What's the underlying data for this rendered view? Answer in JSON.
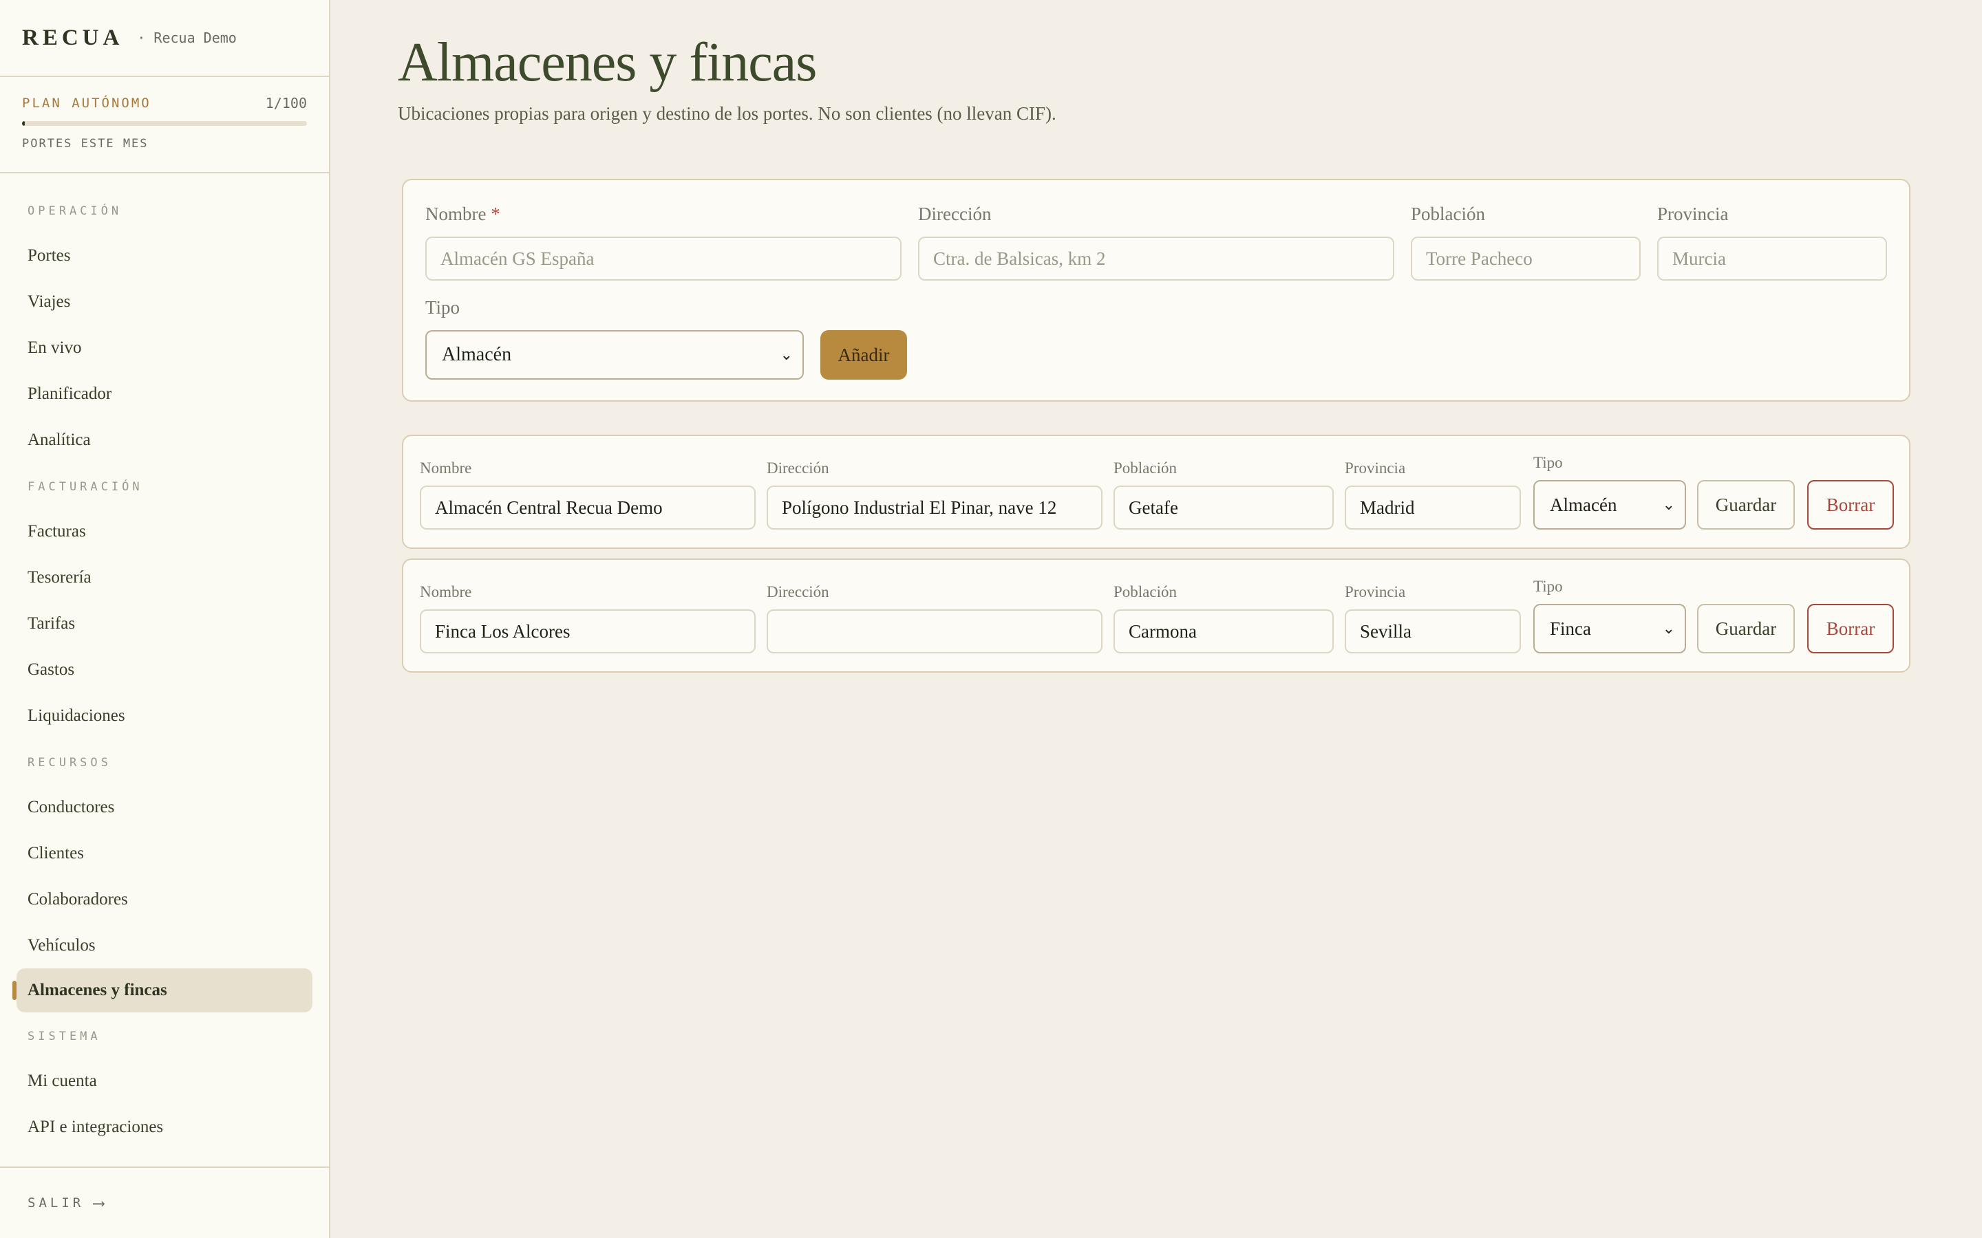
{
  "brand": {
    "logo": "RECUA",
    "workspace": "· Recua Demo"
  },
  "plan": {
    "name": "PLAN AUTÓNOMO",
    "count": "1/100",
    "label": "PORTES ESTE MES",
    "usage_fraction": 0.01
  },
  "nav": {
    "sections": [
      {
        "title": "OPERACIÓN",
        "items": [
          "Portes",
          "Viajes",
          "En vivo",
          "Planificador",
          "Analítica"
        ]
      },
      {
        "title": "FACTURACIÓN",
        "items": [
          "Facturas",
          "Tesorería",
          "Tarifas",
          "Gastos",
          "Liquidaciones"
        ]
      },
      {
        "title": "RECURSOS",
        "items": [
          "Conductores",
          "Clientes",
          "Colaboradores",
          "Vehículos",
          "Almacenes y fincas"
        ]
      },
      {
        "title": "SISTEMA",
        "items": [
          "Mi cuenta",
          "API e integraciones"
        ]
      }
    ],
    "active": "Almacenes y fincas",
    "logout": "SALIR",
    "logout_arrow": "⟶"
  },
  "page": {
    "title": "Almacenes y fincas",
    "subtitle": "Ubicaciones propias para origen y destino de los portes. No son clientes (no llevan CIF)."
  },
  "new_form": {
    "nombre_label": "Nombre",
    "required_mark": "*",
    "nombre_placeholder": "Almacén GS España",
    "direccion_label": "Dirección",
    "direccion_placeholder": "Ctra. de Balsicas, km 2",
    "poblacion_label": "Población",
    "poblacion_placeholder": "Torre Pacheco",
    "provincia_label": "Provincia",
    "provincia_placeholder": "Murcia",
    "tipo_label": "Tipo",
    "tipo_value": "Almacén",
    "add_button": "Añadir"
  },
  "row_labels": {
    "nombre": "Nombre",
    "direccion": "Dirección",
    "poblacion": "Población",
    "provincia": "Provincia",
    "tipo": "Tipo",
    "save": "Guardar",
    "delete": "Borrar"
  },
  "rows": [
    {
      "nombre": "Almacén Central Recua Demo",
      "direccion": "Polígono Industrial El Pinar, nave 12",
      "poblacion": "Getafe",
      "provincia": "Madrid",
      "tipo": "Almacén"
    },
    {
      "nombre": "Finca Los Alcores",
      "direccion": "",
      "poblacion": "Carmona",
      "provincia": "Sevilla",
      "tipo": "Finca"
    }
  ]
}
